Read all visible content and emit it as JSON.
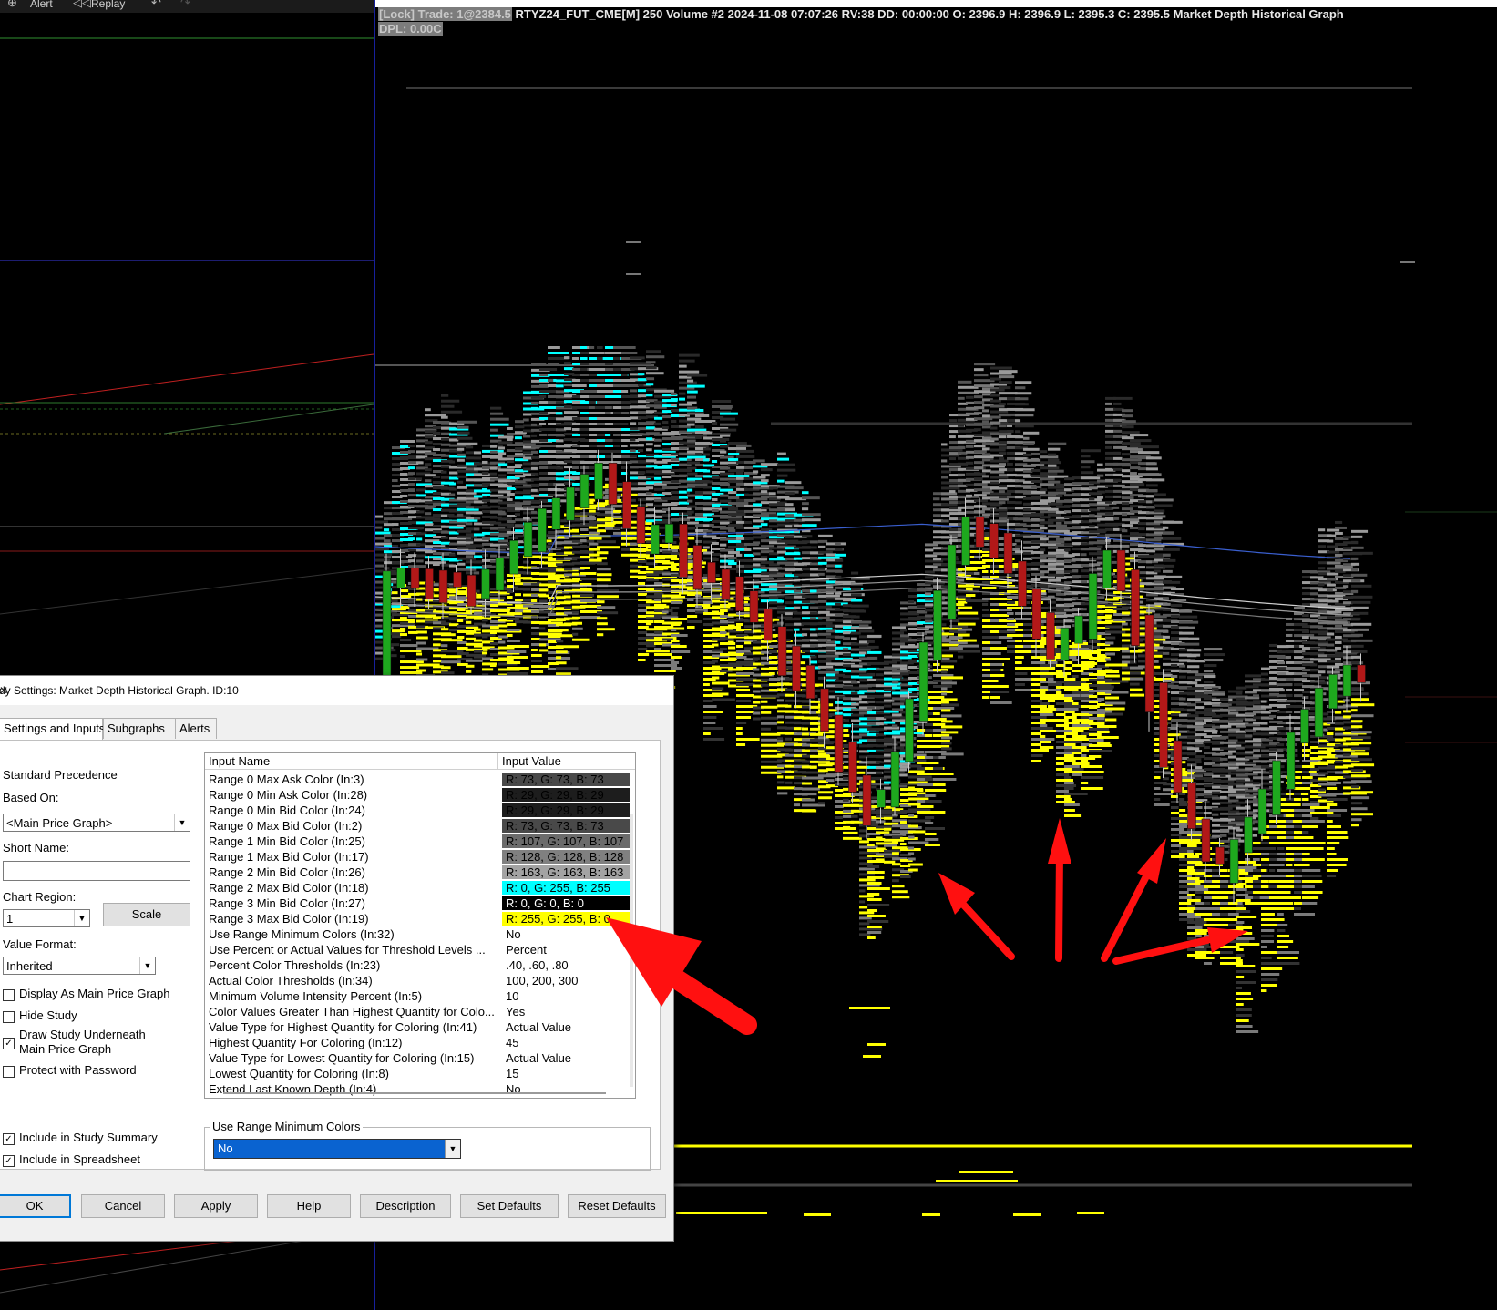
{
  "toolbar": {
    "alert": "Alert",
    "replay": "Replay"
  },
  "chart": {
    "header_lock": "[Lock] Trade: 1@2384.5",
    "header_rest": " RTYZ24_FUT_CME[M]  250 Volume #2 2024-11-08 07:07:26 RV:38 DD: 00:00:00 O: 2396.9 H: 2396.9 L: 2395.3 C: 2395.5 Market Depth Historical Graph",
    "dpl": "DPL: 0.00C",
    "colors": {
      "bull": "#1ea81e",
      "bear": "#b21818",
      "cyan": "#00ffff",
      "yellow": "#ffff00",
      "arrow": "#ff1010"
    }
  },
  "dialog": {
    "title": "dy Settings: Market Depth Historical Graph. ID:10",
    "tabs": [
      "Settings and Inputs",
      "Subgraphs",
      "Alerts"
    ],
    "left": {
      "standard_precedence": "Standard Precedence",
      "based_on_label": "Based On:",
      "based_on_value": "<Main Price Graph>",
      "short_name_label": "Short Name:",
      "chart_region_label": "Chart Region:",
      "chart_region_value": "1",
      "scale_button": "Scale",
      "value_format_label": "Value Format:",
      "value_format_value": "Inherited",
      "display_main": "Display As Main Price Graph",
      "hide_study": "Hide Study",
      "draw_underneath_1": "Draw Study Underneath",
      "draw_underneath_2": "Main Price Graph",
      "protect_password": "Protect with Password",
      "include_summary": "Include in Study Summary",
      "include_spreadsheet": "Include in Spreadsheet"
    },
    "grid": {
      "col_name": "Input Name",
      "col_value": "Input Value",
      "rows": [
        {
          "name": "Range 0 Max Ask Color  (In:3)",
          "value": "R: 73, G: 73, B: 73",
          "bg": "#494949",
          "fg": "#000000"
        },
        {
          "name": "Range 0 Min Ask Color  (In:28)",
          "value": "R: 29, G: 29, B: 29",
          "bg": "#1d1d1d",
          "fg": "#000000"
        },
        {
          "name": "Range 0 Min Bid Color  (In:24)",
          "value": "R: 29, G: 29, B: 29",
          "bg": "#1d1d1d",
          "fg": "#000000"
        },
        {
          "name": "Range 0 Max Bid Color  (In:2)",
          "value": "R: 73, G: 73, B: 73",
          "bg": "#494949",
          "fg": "#000000"
        },
        {
          "name": "Range 1 Min Bid Color  (In:25)",
          "value": "R: 107, G: 107, B: 107",
          "bg": "#6b6b6b",
          "fg": "#000000"
        },
        {
          "name": "Range 1 Max Bid Color  (In:17)",
          "value": "R: 128, G: 128, B: 128",
          "bg": "#808080",
          "fg": "#000000"
        },
        {
          "name": "Range 2 Min Bid Color  (In:26)",
          "value": "R: 163, G: 163, B: 163",
          "bg": "#a3a3a3",
          "fg": "#000000"
        },
        {
          "name": "Range 2 Max Bid Color  (In:18)",
          "value": "R: 0, G: 255, B: 255",
          "bg": "#00ffff",
          "fg": "#000000"
        },
        {
          "name": "Range 3 Min Bid Color  (In:27)",
          "value": "R: 0, G: 0, B: 0",
          "bg": "#000000",
          "fg": "#ffffff"
        },
        {
          "name": "Range 3 Max Bid Color  (In:19)",
          "value": "R: 255, G: 255, B: 0",
          "bg": "#ffff00",
          "fg": "#000000"
        },
        {
          "name": "Use Range Minimum Colors  (In:32)",
          "value": "No",
          "bg": "",
          "fg": "#000000"
        },
        {
          "name": "Use Percent or Actual Values for Threshold Levels  ...",
          "value": "Percent",
          "bg": "",
          "fg": "#000000"
        },
        {
          "name": "Percent Color Thresholds  (In:23)",
          "value": ".40, .60, .80",
          "bg": "",
          "fg": "#000000"
        },
        {
          "name": "Actual Color Thresholds  (In:34)",
          "value": "100, 200, 300",
          "bg": "",
          "fg": "#000000"
        },
        {
          "name": "Minimum Volume Intensity Percent  (In:5)",
          "value": "10",
          "bg": "",
          "fg": "#000000"
        },
        {
          "name": "Color Values Greater Than Highest Quantity for Colo...",
          "value": "Yes",
          "bg": "",
          "fg": "#000000"
        },
        {
          "name": "Value Type for Highest Quantity for Coloring  (In:41)",
          "value": "Actual Value",
          "bg": "",
          "fg": "#000000"
        },
        {
          "name": "Highest Quantity For Coloring  (In:12)",
          "value": "45",
          "bg": "",
          "fg": "#000000"
        },
        {
          "name": "Value Type for Lowest Quantity for Coloring  (In:15)",
          "value": "Actual Value",
          "bg": "",
          "fg": "#000000"
        },
        {
          "name": "Lowest Quantity for Coloring  (In:8)",
          "value": "15",
          "bg": "",
          "fg": "#000000"
        },
        {
          "name": "Extend Last Known Depth  (In:4)",
          "value": "No",
          "bg": "",
          "fg": "#000000"
        }
      ]
    },
    "groupbox": {
      "label": "Use Range Minimum Colors",
      "value": "No"
    },
    "buttons": [
      "OK",
      "Cancel",
      "Apply",
      "Help",
      "Description",
      "Set Defaults",
      "Reset Defaults"
    ]
  }
}
